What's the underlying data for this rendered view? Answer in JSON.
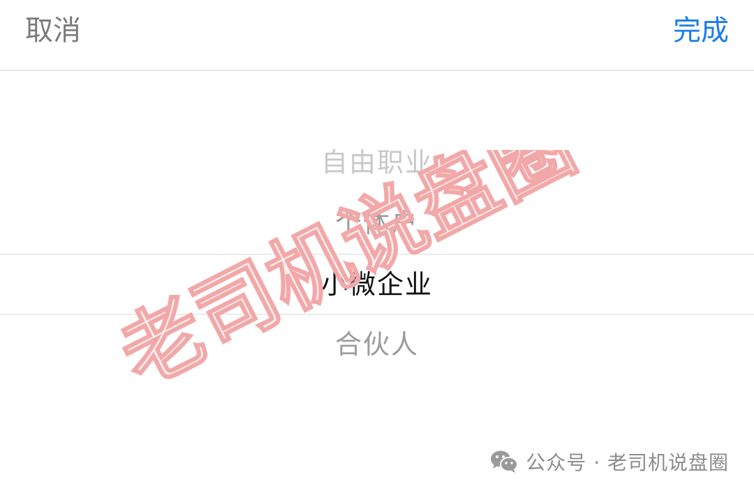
{
  "toolbar": {
    "cancel_label": "取消",
    "done_label": "完成"
  },
  "picker": {
    "options": [
      {
        "label": "自由职业"
      },
      {
        "label": "个体户"
      },
      {
        "label": "小微企业"
      },
      {
        "label": "合伙人"
      }
    ],
    "selected": "小微企业"
  },
  "watermark": {
    "text": "老司机说盘圈"
  },
  "attribution": {
    "icon": "wechat-icon",
    "text": "公众号 · 老司机说盘圈"
  },
  "colors": {
    "accent": "#1a7ee8",
    "cancel": "#7a7a7a",
    "selected_text": "#111111",
    "watermark": "#f2a8a8"
  }
}
